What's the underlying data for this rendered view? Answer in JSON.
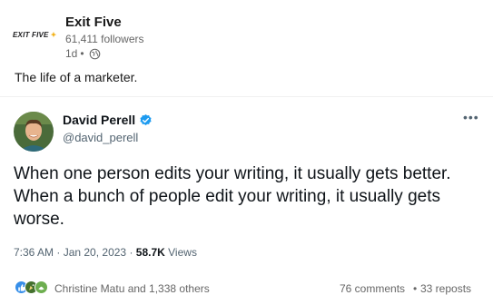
{
  "post": {
    "company_name": "Exit Five",
    "company_logo_text": "EXIT FIVE",
    "followers": "61,411 followers",
    "age": "1d",
    "dot": "•",
    "visibility_icon": "globe-icon",
    "text": "The life of a marketer."
  },
  "tweet": {
    "author_name": "David Perell",
    "handle": "@david_perell",
    "verified_icon": "verified-badge-icon",
    "more_icon": "more-options-icon",
    "more_glyph": "•••",
    "body": "When one person edits your writing, it usually gets better. When a bunch of people edit your writing, it usually gets worse.",
    "time": "7:36 AM",
    "date_sep": " · ",
    "date": "Jan 20, 2023",
    "views_sep": " · ",
    "views_count": "58.7K",
    "views_label": " Views"
  },
  "social": {
    "reactors": "Christine Matu and 1,338 others",
    "comments": "76 comments",
    "separator": "•",
    "reposts": "33 reposts",
    "reaction_icons": [
      "like-icon",
      "celebrate-icon",
      "support-icon"
    ],
    "colors": {
      "like": "#378fe9",
      "celebrate": "#44712e",
      "support": "#6dae4f"
    }
  },
  "colors": {
    "verified": "#1d9bf0",
    "muted": "#666666",
    "tweet_text": "#0f1419",
    "logo_accent": "#f2b21a"
  }
}
